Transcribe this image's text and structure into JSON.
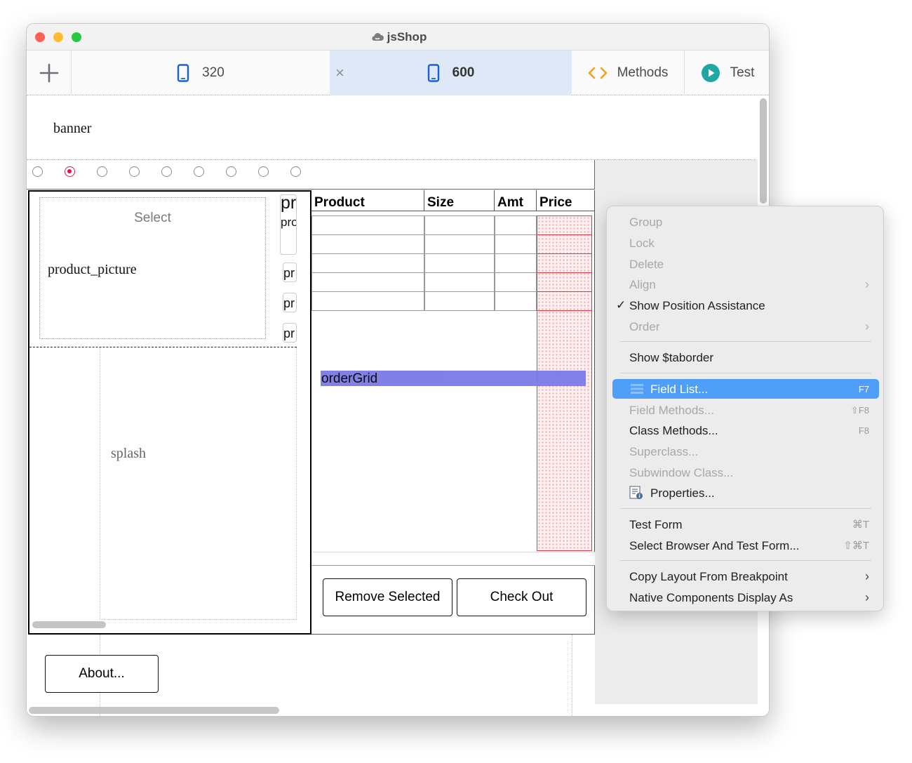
{
  "window": {
    "title": "jsShop"
  },
  "toolbar": {
    "add_icon": "plus-icon",
    "tabs": [
      {
        "label": "320",
        "icon": "phone-icon"
      },
      {
        "label": "600",
        "icon": "phone-icon",
        "close": "×"
      },
      {
        "label": "Methods",
        "icon": "code-brackets-icon"
      },
      {
        "label": "Test",
        "icon": "play-icon"
      }
    ]
  },
  "form": {
    "banner": "banner",
    "radio_count": 9,
    "selected_radio": 2,
    "left_panel": {
      "select_label": "Select",
      "picture_label": "product_picture",
      "side_title": "pr",
      "side_sub": "pro",
      "side_items": [
        "pr",
        "pr",
        "pr"
      ],
      "splash_label": "splash"
    },
    "grid": {
      "columns": [
        "Product",
        "Size",
        "Amt",
        "Price"
      ],
      "row_count": 5,
      "name_label": "orderGrid"
    },
    "buttons": {
      "remove": "Remove Selected",
      "checkout": "Check Out",
      "about": "About..."
    }
  },
  "context_menu": {
    "group": "Group",
    "lock": "Lock",
    "delete": "Delete",
    "align": "Align",
    "show_position": "Show Position Assistance",
    "show_position_check": "✓",
    "order": "Order",
    "show_taborder": "Show $taborder",
    "field_list": "Field List...",
    "field_list_shortcut": "F7",
    "field_methods": "Field Methods...",
    "field_methods_shortcut": "⇧F8",
    "class_methods": "Class Methods...",
    "class_methods_shortcut": "F8",
    "superclass": "Superclass...",
    "subwindow_class": "Subwindow Class...",
    "properties": "Properties...",
    "test_form": "Test Form",
    "test_form_shortcut": "⌘T",
    "select_browser": "Select Browser And Test Form...",
    "select_browser_shortcut": "⇧⌘T",
    "copy_layout": "Copy Layout From Breakpoint",
    "native_components": "Native Components Display As",
    "submenu_arrow": "›"
  },
  "colors": {
    "accent": "#1d5fd6",
    "menu_highlight": "#4f9ef8",
    "grid_label_bg": "#7a7ae6",
    "radio_selected": "#d8164a",
    "methods_icon": "#f2a01e",
    "test_icon": "#1fa7a6",
    "price_overlay": "#e03a4a"
  }
}
